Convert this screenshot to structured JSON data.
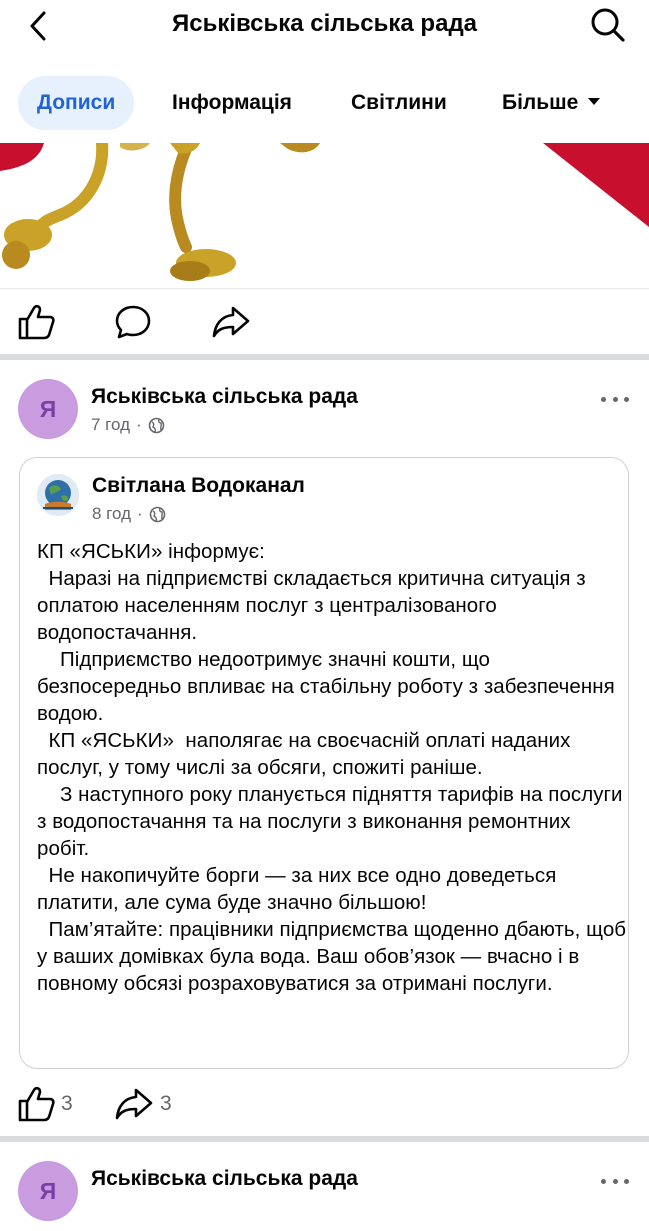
{
  "header": {
    "title": "Яськівська сільська рада"
  },
  "tabs": [
    {
      "label": "Дописи",
      "active": true
    },
    {
      "label": "Інформація"
    },
    {
      "label": "Світлини"
    },
    {
      "label": "Більше"
    }
  ],
  "post1": {
    "author": "Яськівська сільська рада",
    "avatar_letter": "Я",
    "time": "7 год",
    "likes": "3",
    "shares": "3",
    "shared": {
      "author": "Світлана Водоканал",
      "time": "8 год",
      "text": "КП «ЯСЬКИ» інформує:\n  Наразі на підприємстві складається критична ситуація з оплатою населенням послуг з централізованого водопостачання.\n    Підприємство недоотримує значні кошти, що безпосередньо впливає на стабільну роботу з забезпечення водою.\n  КП «ЯСЬКИ»  наполягає на своєчасній оплаті наданих послуг, у тому числі за обсяги, спожиті раніше.\n    З наступного року планується підняття тарифів на послуги з водопостачання та на послуги з виконання ремонтних робіт.\n  Не накопичуйте борги — за них все одно доведеться платити, але сума буде значно більшою!\n  Пам’ятайте: працівники підприємства щоденно дбають, щоб у ваших домівках була вода. Ваш обов’язок — вчасно і в повному обсязі розраховуватися за отримані послуги."
    }
  },
  "post2": {
    "author": "Яськівська сільська рада",
    "avatar_letter": "Я"
  },
  "colors": {
    "accent": "#1f63d4",
    "tab_active_bg": "#e7f0fd",
    "avatar_bg": "#c99ce0",
    "separator": "#d9dbde",
    "hero_red": "#c8102e",
    "hero_gold": "#c9a227"
  },
  "icons": [
    "back-chevron-icon",
    "search-icon",
    "like-icon",
    "comment-icon",
    "share-icon",
    "globe-icon",
    "more-icon"
  ]
}
